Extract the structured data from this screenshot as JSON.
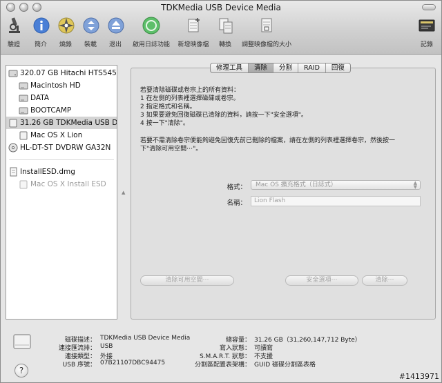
{
  "window": {
    "title": "TDKMedia USB Device Media"
  },
  "toolbar": {
    "verify": "驗證",
    "info": "簡介",
    "burn": "燒錄",
    "mount": "裝載",
    "eject": "退出",
    "enable_journaling": "啟用日誌功能",
    "new_image": "新增映像檔",
    "convert": "轉換",
    "resize_image": "調整映像檔的大小",
    "log": "記錄"
  },
  "sidebar": {
    "items": [
      {
        "label": "320.07 GB Hitachi HTS545..."
      },
      {
        "label": "Macintosh HD"
      },
      {
        "label": "DATA"
      },
      {
        "label": "BOOTCAMP"
      },
      {
        "label": "31.26 GB TDKMedia USB D..."
      },
      {
        "label": "Mac OS X Lion"
      },
      {
        "label": "HL-DT-ST DVDRW GA32N"
      },
      {
        "label": "InstallESD.dmg"
      },
      {
        "label": "Mac OS X Install ESD"
      }
    ]
  },
  "tabs": {
    "first_aid": "修理工具",
    "erase": "清除",
    "partition": "分割",
    "raid": "RAID",
    "restore": "回復"
  },
  "instructions": {
    "line1": "若要清除磁碟或卷宗上的所有資料：",
    "line2": "1  在左側的列表裡選擇磁碟或卷宗。",
    "line3": "2  指定格式和名稱。",
    "line4": "3  如果要避免回復磁碟已清除的資料，請按一下\"安全選項\"。",
    "line5": "4  按一下\"清除\"。",
    "line6": "若要不需清除卷宗便能夠避免回復先前已刪除的檔案，請在左側的列表裡選擇卷宗，然後按一",
    "line7": "下\"清除可用空間⋯\"。"
  },
  "form": {
    "format_label": "格式：",
    "format_value": "Mac OS 擴充格式（日誌式）",
    "name_label": "名稱：",
    "name_value": "Lion Flash"
  },
  "buttons": {
    "erase_free_space": "清除可用空間⋯",
    "security_options": "安全選項⋯",
    "erase": "清除⋯"
  },
  "info": {
    "disk_description_label": "磁碟描述：",
    "disk_description_value": "TDKMedia USB Device Media",
    "connection_bus_label": "連接匯流排：",
    "connection_bus_value": "USB",
    "connection_type_label": "連接類型：",
    "connection_type_value": "外接",
    "usb_serial_label": "USB 序號：",
    "usb_serial_value": "07B21107DBC94475",
    "total_capacity_label": "總容量：",
    "total_capacity_value": "31.26 GB（31,260,147,712 Byte）",
    "write_status_label": "寫入狀態：",
    "write_status_value": "可讀寫",
    "smart_status_label": "S.M.A.R.T. 狀態：",
    "smart_status_value": "不支援",
    "partition_scheme_label": "分割區配置表架構：",
    "partition_scheme_value": "GUID 磁碟分割區表格"
  },
  "help": {
    "label": "?"
  },
  "watermark": "#1413971"
}
